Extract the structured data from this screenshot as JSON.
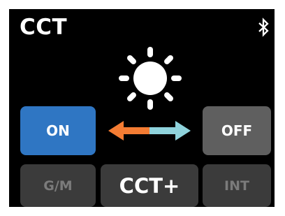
{
  "header": {
    "title": "CCT",
    "bluetooth_icon": "bluetooth-icon"
  },
  "indicator": {
    "icon": "sun-brightness-icon",
    "color": "#ffffff"
  },
  "controls": {
    "on_label": "ON",
    "off_label": "OFF",
    "arrow_icon": "double-arrow-icon",
    "arrow_left_color": "#f47c33",
    "arrow_right_color": "#8fd3dc"
  },
  "bottom_bar": {
    "gm_label": "G/M",
    "cct_plus_label": "CCT+",
    "int_label": "INT"
  },
  "colors": {
    "background": "#000000",
    "on_button": "#2f76c3",
    "off_button": "#5f5f5f",
    "inactive_button": "#3b3b3b",
    "inactive_text": "#7b7b7b",
    "active_text": "#ffffff"
  }
}
